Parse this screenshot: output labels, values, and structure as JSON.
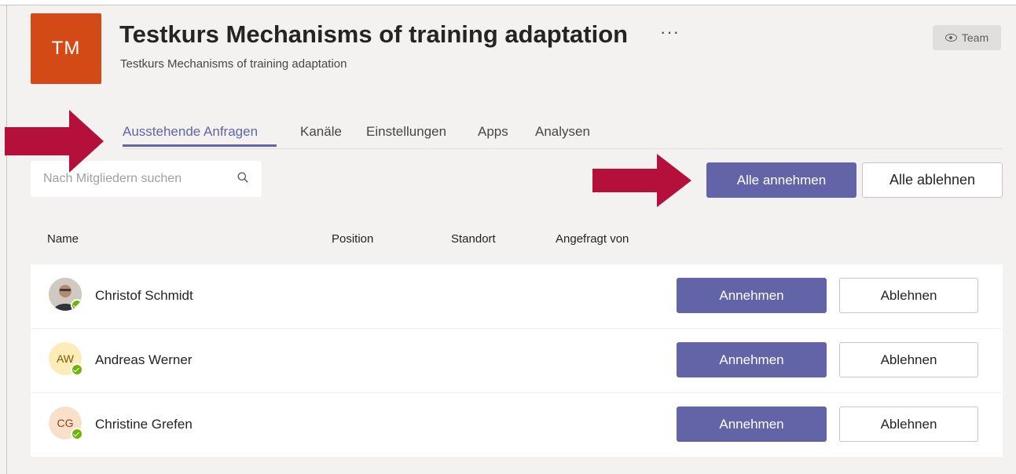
{
  "team": {
    "initials": "TM",
    "title": "Testkurs Mechanisms of training adaptation",
    "more": "···",
    "subtitle": "Testkurs Mechanisms of training adaptation",
    "badge": "Team",
    "badge_icon": "eye-icon",
    "avatar_color": "#d34a17"
  },
  "tabs": [
    {
      "label": "Ausstehende Anfragen",
      "active": true
    },
    {
      "label": "Kanäle"
    },
    {
      "label": "Einstellungen"
    },
    {
      "label": "Apps"
    },
    {
      "label": "Analysen"
    }
  ],
  "search": {
    "placeholder": "Nach Mitgliedern suchen",
    "icon": "search-icon"
  },
  "actions": {
    "accept_all": "Alle annehmen",
    "reject_all": "Alle ablehnen"
  },
  "columns": [
    "Name",
    "Position",
    "Standort",
    "Angefragt von"
  ],
  "requests": [
    {
      "name": "Christof Schmidt",
      "initials": "",
      "avatar": "photo",
      "accept": "Annehmen",
      "reject": "Ablehnen"
    },
    {
      "name": "Andreas Werner",
      "initials": "AW",
      "accept": "Annehmen",
      "reject": "Ablehnen"
    },
    {
      "name": "Christine Grefen",
      "initials": "CG",
      "accept": "Annehmen",
      "reject": "Ablehnen"
    }
  ],
  "colors": {
    "accent": "#6264a7",
    "arrow": "#b5103c",
    "status": "#6bb700"
  }
}
